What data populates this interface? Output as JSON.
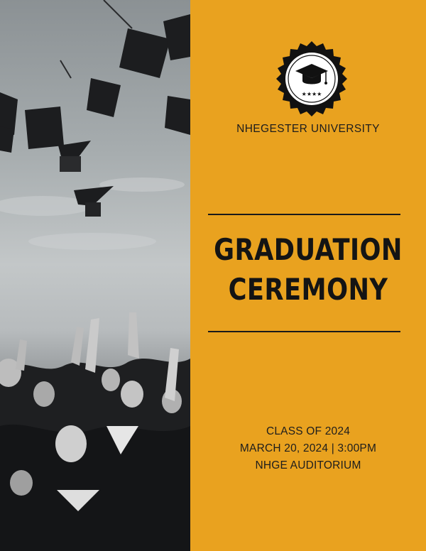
{
  "university": {
    "name": "NHEGESTER UNIVERSITY",
    "seal_icon": "graduation-cap-icon",
    "seal_stars": "★★★★"
  },
  "title": {
    "line1": "GRADUATION",
    "line2": "CEREMONY"
  },
  "details": {
    "class": "CLASS OF 2024",
    "datetime": "MARCH 20, 2024 | 3:00PM",
    "venue": "NHGE AUDITORIUM"
  },
  "colors": {
    "accent": "#e9a21f",
    "text": "#1d1d1d"
  },
  "photo": {
    "subject": "graduates-throwing-caps-photo"
  }
}
